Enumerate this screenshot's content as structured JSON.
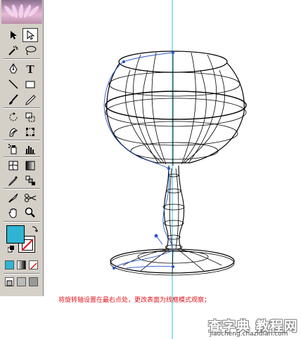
{
  "toolbox": {
    "type_tool_glyph": "T",
    "fill_color": "#2fb5d3",
    "stroke_color": "#ffffff",
    "tools": [
      {
        "name": "selection-tool",
        "icon": "black-arrow"
      },
      {
        "name": "direct-selection-tool",
        "icon": "white-arrow",
        "selected": true
      },
      {
        "name": "magic-wand-tool",
        "icon": "magic-wand"
      },
      {
        "name": "lasso-tool",
        "icon": "lasso"
      },
      {
        "name": "pen-tool",
        "icon": "pen-nib"
      },
      {
        "name": "type-tool",
        "icon": "type-T"
      },
      {
        "name": "line-tool",
        "icon": "diagonal-line"
      },
      {
        "name": "rectangle-tool",
        "icon": "rectangle"
      },
      {
        "name": "paintbrush-tool",
        "icon": "brush"
      },
      {
        "name": "pencil-tool",
        "icon": "pencil"
      },
      {
        "name": "rotate-tool",
        "icon": "rotate"
      },
      {
        "name": "scale-tool",
        "icon": "scale"
      },
      {
        "name": "warp-tool",
        "icon": "warp"
      },
      {
        "name": "free-transform-tool",
        "icon": "free-transform"
      },
      {
        "name": "symbol-sprayer-tool",
        "icon": "symbol-sprayer"
      },
      {
        "name": "column-graph-tool",
        "icon": "bar-graph"
      },
      {
        "name": "mesh-tool",
        "icon": "mesh"
      },
      {
        "name": "gradient-tool",
        "icon": "gradient"
      },
      {
        "name": "eyedropper-tool",
        "icon": "eyedropper"
      },
      {
        "name": "blend-tool",
        "icon": "blend"
      },
      {
        "name": "slice-tool",
        "icon": "slice-knife"
      },
      {
        "name": "scissors-tool",
        "icon": "scissors"
      },
      {
        "name": "hand-tool",
        "icon": "hand"
      },
      {
        "name": "zoom-tool",
        "icon": "magnifier"
      }
    ]
  },
  "caption": "将旋转轴设置在最右点处，更改表面为线框模式观察；",
  "watermark": {
    "main": "查字典 教程网",
    "sub": "jiaocheng.chazidian.com"
  }
}
